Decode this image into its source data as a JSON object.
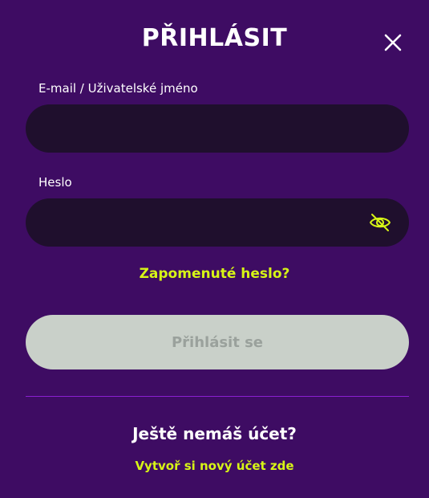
{
  "modal": {
    "title": "PŘIHLÁSIT",
    "close_icon": "close-icon"
  },
  "form": {
    "email": {
      "label": "E-mail / Uživatelské jméno",
      "value": "",
      "placeholder": ""
    },
    "password": {
      "label": "Heslo",
      "value": "",
      "placeholder": "",
      "toggle_icon": "eye-slash-icon"
    },
    "forgot_link": "Zapomenuté heslo?",
    "submit_label": "Přihlásit se"
  },
  "signup": {
    "prompt": "Ještě nemáš účet?",
    "link": "Vytvoř si nový účet zde"
  },
  "colors": {
    "background": "#3e0c63",
    "field_background": "#1f0f2d",
    "accent": "#d7f516",
    "button_disabled": "#c9d0c9",
    "button_text_disabled": "#9aa19c",
    "divider": "#8a1fd0"
  }
}
